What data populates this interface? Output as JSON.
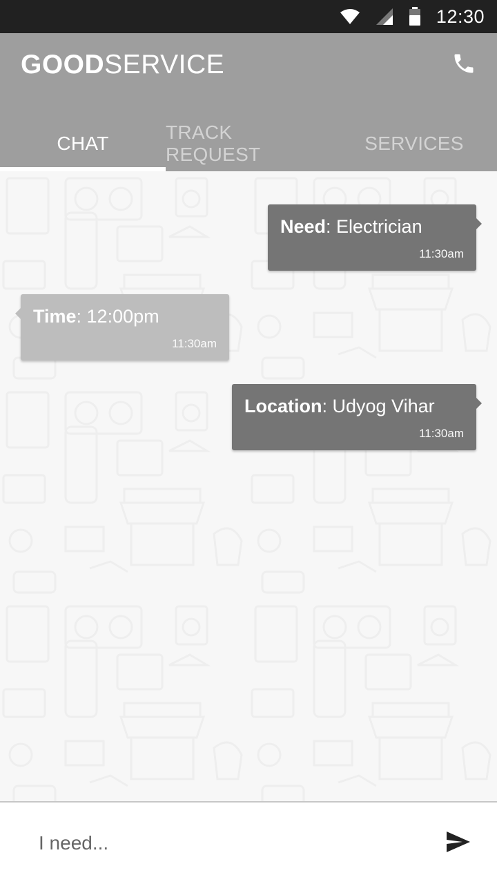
{
  "status_bar": {
    "time": "12:30",
    "icons": [
      "wifi-icon",
      "signal-icon",
      "battery-icon"
    ]
  },
  "app_bar": {
    "brand_bold": "GOOD",
    "brand_regular": "SERVICE",
    "call_icon": "phone-icon",
    "background": "#9e9e9e"
  },
  "tabs": [
    {
      "label": "CHAT",
      "active": true
    },
    {
      "label": "TRACK REQUEST",
      "active": false
    },
    {
      "label": "SERVICES",
      "active": false
    }
  ],
  "messages": [
    {
      "direction": "outgoing",
      "label": "Need",
      "text": ": Electrician",
      "time": "11:30am"
    },
    {
      "direction": "incoming",
      "label": "Time",
      "text": ": 12:00pm",
      "time": "11:30am"
    },
    {
      "direction": "outgoing",
      "label": "Location",
      "text": ": Udyog Vihar",
      "time": "11:30am"
    }
  ],
  "composer": {
    "placeholder": "I need...",
    "send_icon": "send-icon"
  },
  "colors": {
    "status_bar": "#212121",
    "outgoing_bubble": "#757575",
    "incoming_bubble": "#bdbdbd",
    "chat_background": "#f7f7f7"
  }
}
